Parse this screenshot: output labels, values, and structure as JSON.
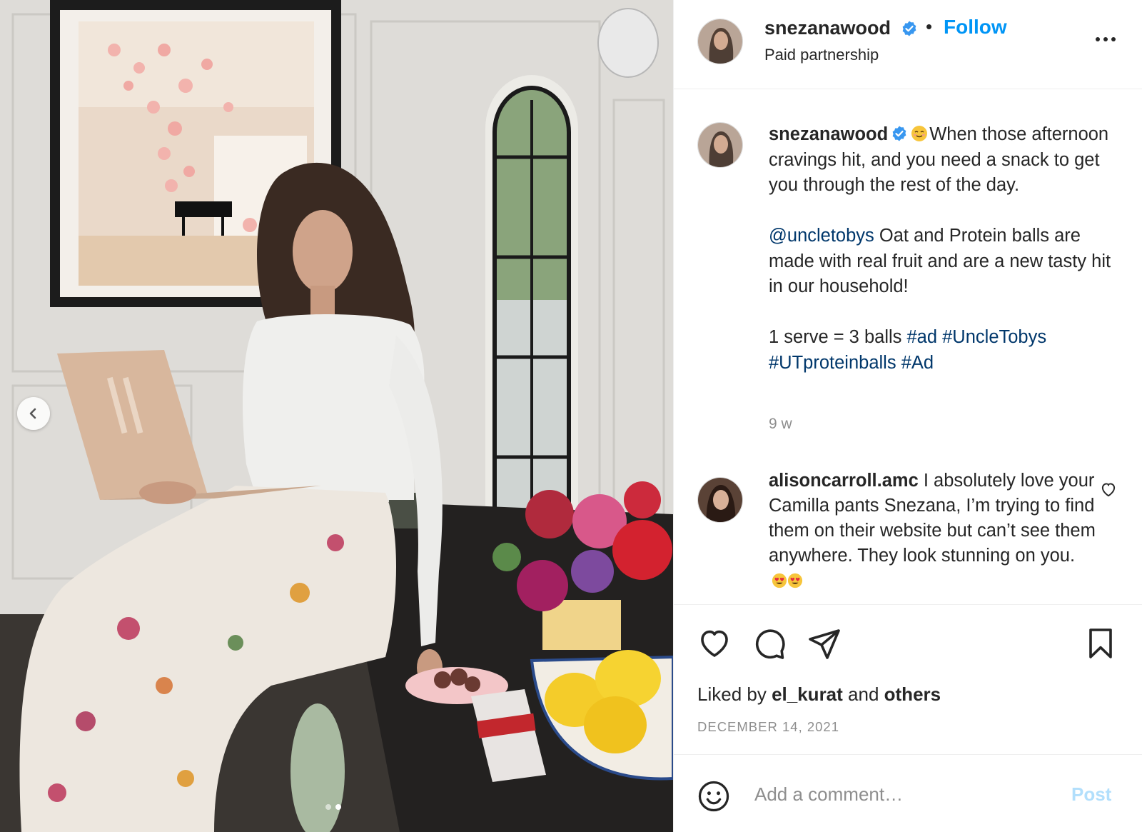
{
  "post": {
    "author": {
      "username": "snezanawood",
      "verified": true,
      "subtitle": "Paid partnership"
    },
    "follow_label": "Follow",
    "separator": "•",
    "caption": {
      "line1": "When those afternoon cravings hit, and you need a snack to get you through the rest of the day.",
      "mention": "@uncletobys",
      "line2": " Oat and Protein balls are made with real fruit and are a new tasty hit in our household!",
      "line3_prefix": "1 serve = 3 balls ",
      "hashtags": [
        "#ad",
        "#UncleTobys",
        "#UTproteinballs",
        "#Ad"
      ]
    },
    "age": "9 w",
    "comment": {
      "username": "alisoncarroll.amc",
      "text": " I absolutely love your Camilla pants Snezana, I’m trying to find them on their website but can’t see them anywhere. They look stunning on you."
    },
    "likes": {
      "prefix": "Liked by ",
      "user": "el_kurat",
      "middle": " and ",
      "suffix": "others"
    },
    "date": "DECEMBER 14, 2021",
    "add_comment_placeholder": "Add a comment…",
    "post_label": "Post",
    "carousel": {
      "current": 2,
      "total": 2
    }
  },
  "icons": {
    "verified": "verified-badge-icon",
    "more": "more-options-icon",
    "like": "heart-icon",
    "comment": "comment-bubble-icon",
    "share": "paper-plane-icon",
    "save": "bookmark-icon",
    "emoji": "smile-icon",
    "prev": "chevron-left-icon"
  },
  "colors": {
    "link": "#00376b",
    "follow": "#0095f6",
    "verified": "#3897f0",
    "muted": "#8e8e8e",
    "post_disabled": "#b2dffc"
  }
}
